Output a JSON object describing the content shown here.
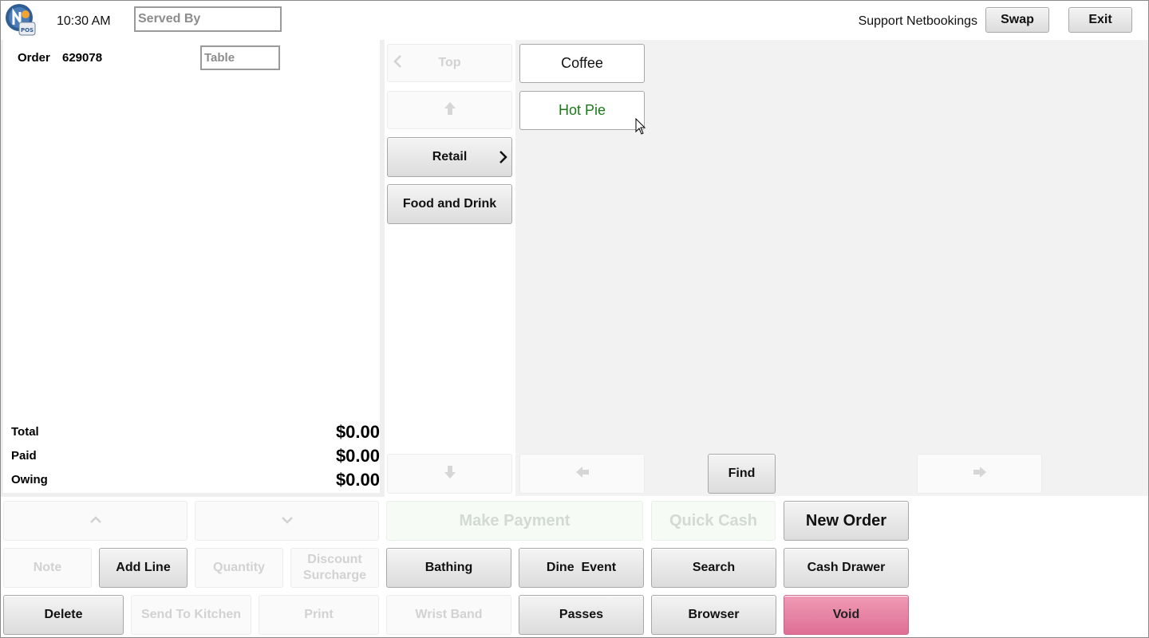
{
  "header": {
    "time": "10:30 AM",
    "served_by_placeholder": "Served By",
    "operator": "Support Netbookings",
    "swap_label": "Swap",
    "exit_label": "Exit"
  },
  "order": {
    "label": "Order",
    "number": "629078",
    "table_placeholder": "Table",
    "totals": [
      {
        "label": "Total",
        "value": "$0.00"
      },
      {
        "label": "Paid",
        "value": "$0.00"
      },
      {
        "label": "Owing",
        "value": "$0.00"
      }
    ]
  },
  "categories": {
    "top_label": "Top",
    "items": [
      "Retail",
      "Food and Drink"
    ]
  },
  "products": {
    "items": [
      "Coffee",
      "Hot Pie"
    ],
    "find_label": "Find"
  },
  "actions": {
    "make_payment": "Make Payment",
    "quick_cash": "Quick Cash",
    "new_order": "New Order",
    "note": "Note",
    "add_line": "Add Line",
    "quantity": "Quantity",
    "discount_line1": "Discount",
    "discount_line2": "Surcharge",
    "bathing": "Bathing",
    "dine_event": "Dine  Event",
    "search": "Search",
    "cash_drawer": "Cash Drawer",
    "delete": "Delete",
    "send_to_kitchen": "Send To Kitchen",
    "print": "Print",
    "wrist_band": "Wrist Band",
    "passes": "Passes",
    "browser": "Browser",
    "void": "Void"
  },
  "colors": {
    "accent_green_text": "#1a7a1a",
    "void_pink": "#e47fa2",
    "panel_grey": "#f2f2f2"
  },
  "icons": {
    "logo": "nb-pos-logo",
    "scroll_up": "arrow-up-icon",
    "scroll_down": "arrow-down-icon",
    "left": "arrow-left-icon",
    "right": "arrow-right-icon",
    "chevron_up": "chevron-up-icon",
    "chevron_down": "chevron-down-icon",
    "chevron_right": "chevron-right-icon",
    "chevron_left": "chevron-left-icon"
  }
}
